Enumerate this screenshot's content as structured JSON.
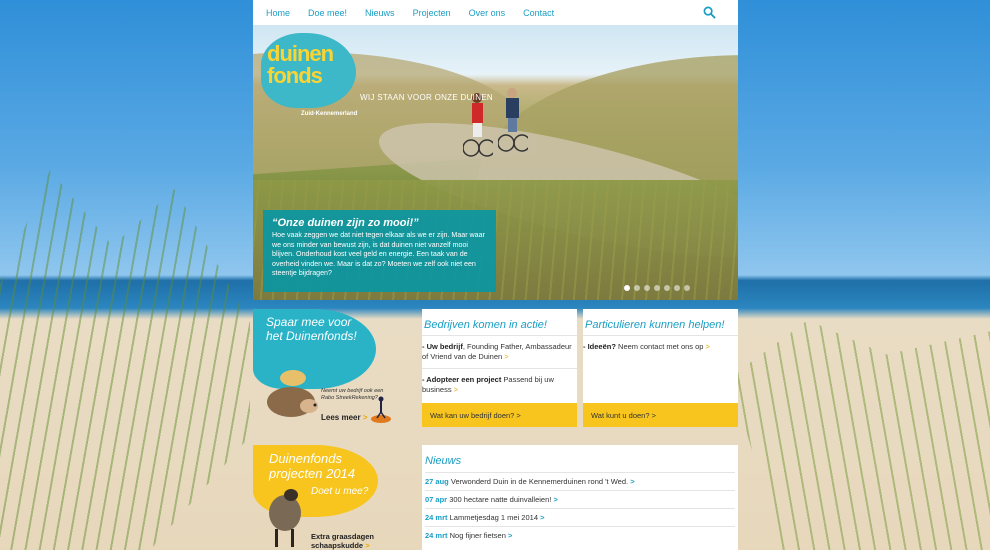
{
  "nav": {
    "items": [
      "Home",
      "Doe mee!",
      "Nieuws",
      "Projecten",
      "Over ons",
      "Contact"
    ]
  },
  "hero": {
    "logo_line1": "duinen",
    "logo_line2": "fonds",
    "logo_sub": "Zuid-Kennemerland",
    "tagline": "WIJ STAAN VOOR ONZE DUINEN",
    "quote_title": "“Onze duinen zijn zo mooi!”",
    "quote_text": "Hoe vaak zeggen we dat niet tegen elkaar als we er zijn. Maar waar we ons minder van bewust zijn, is dat duinen niet vanzelf mooi blijven. Onderhoud kost veel geld en energie. Een taak van de overheid vinden we. Maar is dat zo? Moeten we zelf ook niet een steentje bijdragen?"
  },
  "spaar": {
    "title_line1": "Spaar mee voor",
    "title_line2": "het Duinenfonds!",
    "small_text": "Neemt uw bedrijf ook een Rabo StreekRekening?",
    "lees_meer": "Lees meer",
    "arrow": ">"
  },
  "bedrijven": {
    "title": "Bedrijven komen in actie!",
    "item1_bold": "- Uw bedrijf",
    "item1_text": ", Founding Father, Ambassadeur of Vriend van de Duinen",
    "item2_bold": "- Adopteer een project",
    "item2_text": " Passend bij uw business",
    "button": "Wat kan uw bedrijf doen? >"
  },
  "particulieren": {
    "title": "Particulieren kunnen helpen!",
    "item1_bold": "- Ideeën?",
    "item1_text": " Neem contact met ons op",
    "button": "Wat kunt u doen? >"
  },
  "projecten": {
    "title_line1": "Duinenfonds",
    "title_line2": "projecten 2014",
    "doe": "Doet u mee?",
    "extra_line1": "Extra graasdagen",
    "extra_line2": "schaapskudde"
  },
  "news": {
    "title": "Nieuws",
    "items": [
      {
        "date": "27 aug",
        "text": "Verwonderd Duin in de Kennemerduinen rond 't Wed."
      },
      {
        "date": "07 apr",
        "text": "300 hectare natte duinvalleien!"
      },
      {
        "date": "24 mrt",
        "text": "Lammetjesdag 1 mei 2014"
      },
      {
        "date": "24 mrt",
        "text": "Nog fijner fietsen"
      }
    ]
  },
  "colors": {
    "accent_blue": "#1a9ec4",
    "teal": "#2ab3c7",
    "yellow": "#f7c51e"
  }
}
